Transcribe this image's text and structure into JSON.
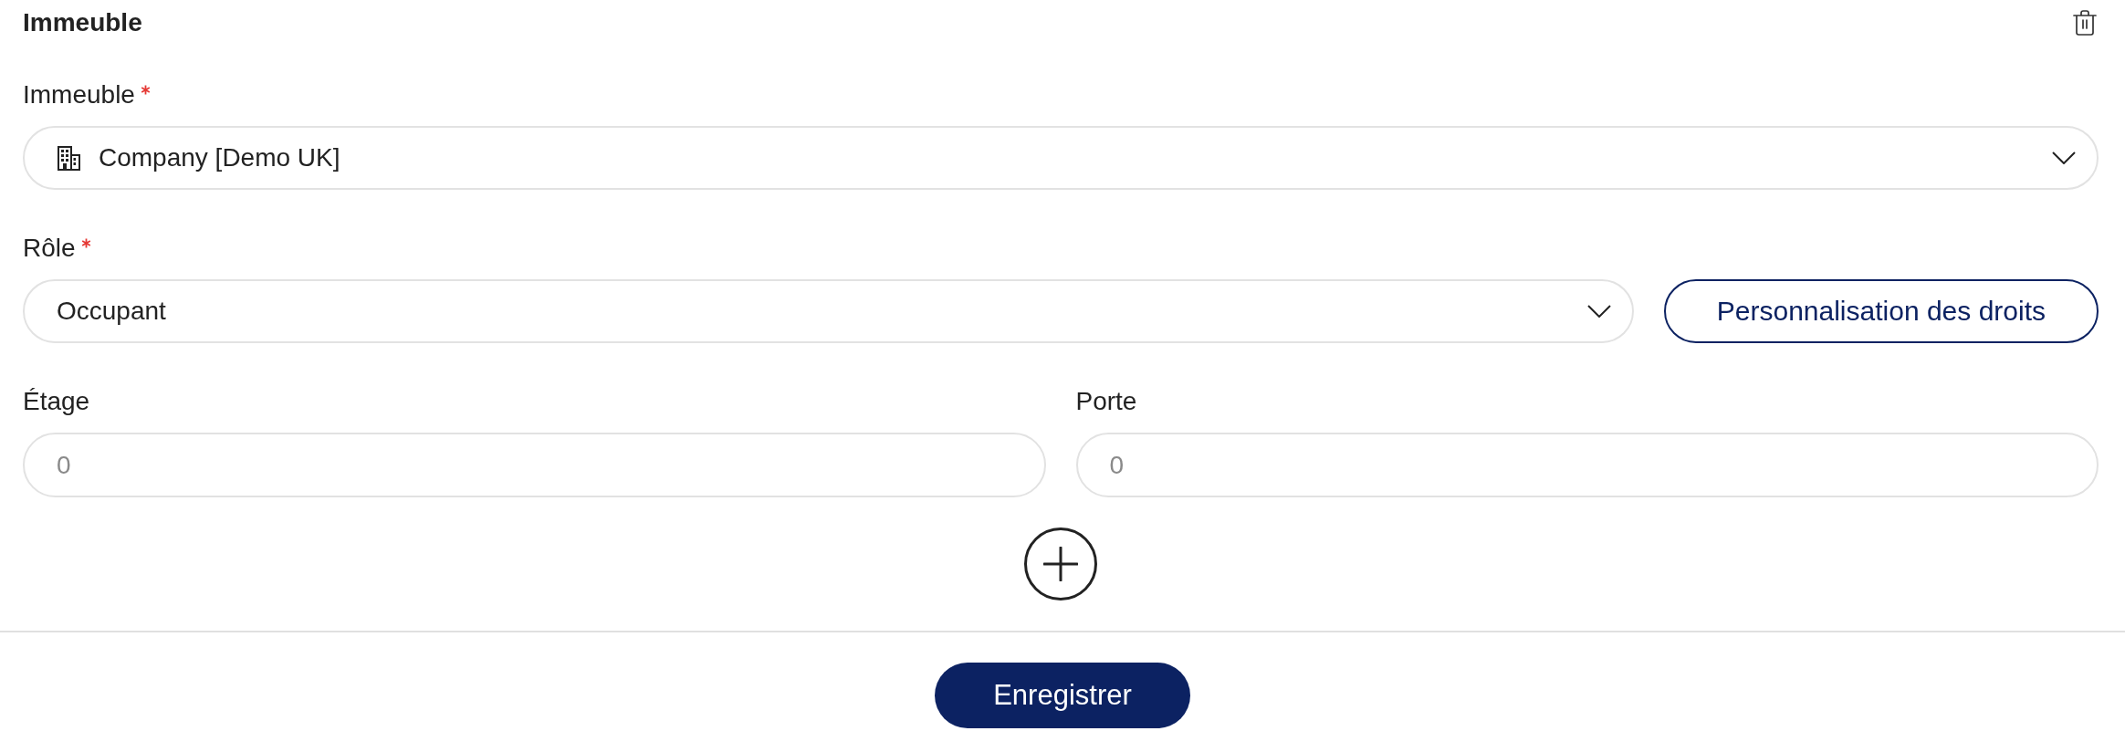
{
  "header": {
    "title": "Immeuble"
  },
  "building": {
    "label": "Immeuble",
    "required": true,
    "value": "Company [Demo UK]"
  },
  "role": {
    "label": "Rôle",
    "required": true,
    "value": "Occupant",
    "button": "Personnalisation des droits"
  },
  "location_fields": [
    {
      "label": "Étage",
      "placeholder": "0"
    },
    {
      "label": "Porte",
      "placeholder": "0"
    }
  ],
  "footer": {
    "save_button": "Enregistrer"
  }
}
